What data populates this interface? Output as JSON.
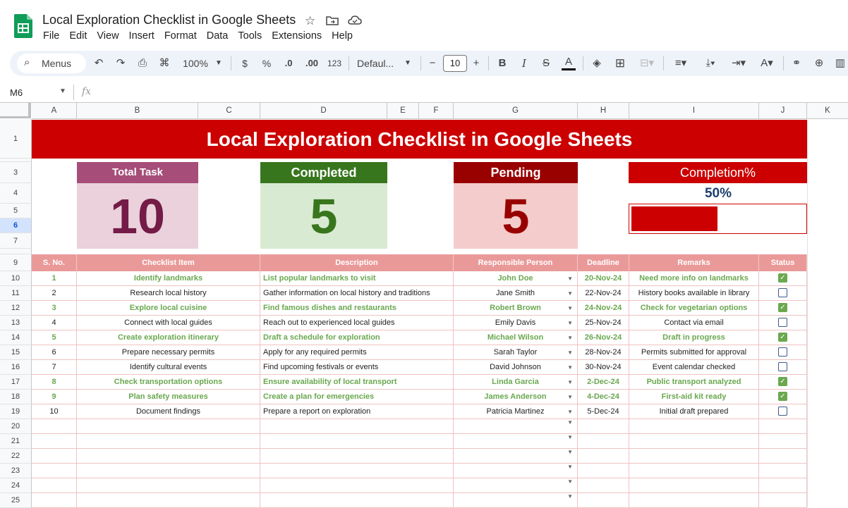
{
  "app": {
    "doc_title": "Local Exploration Checklist in Google Sheets",
    "menus": [
      "File",
      "Edit",
      "View",
      "Insert",
      "Format",
      "Data",
      "Tools",
      "Extensions",
      "Help"
    ],
    "title_icons": [
      "star-icon",
      "move-folder-icon",
      "cloud-saved-icon"
    ]
  },
  "toolbar": {
    "search_label": "Menus",
    "zoom": "100%",
    "currency": "$",
    "percent": "%",
    "decrease_decimal": ".0",
    "increase_decimal": ".00",
    "number_format": "123",
    "font": "Defaul...",
    "font_size": "10",
    "minus": "−",
    "plus": "+",
    "bold": "B",
    "italic": "I",
    "strike": "S",
    "text_color": "A"
  },
  "formula_bar": {
    "cell_ref": "M6",
    "fx": "fx"
  },
  "columns": [
    "A",
    "B",
    "C",
    "D",
    "E",
    "F",
    "G",
    "H",
    "I",
    "J",
    "K"
  ],
  "rows": [
    "1",
    "3",
    "4",
    "5",
    "6",
    "7",
    "9",
    "10",
    "11",
    "12",
    "13",
    "14",
    "15",
    "16",
    "17",
    "18",
    "19",
    "20",
    "21",
    "22",
    "23",
    "24",
    "25"
  ],
  "banner": {
    "title": "Local Exploration Checklist in Google Sheets"
  },
  "kpis": {
    "total": {
      "label": "Total Task",
      "value": "10"
    },
    "completed": {
      "label": "Completed",
      "value": "5"
    },
    "pending": {
      "label": "Pending",
      "value": "5"
    },
    "completion": {
      "label": "Completion%",
      "value": "50%",
      "fraction": 0.5
    }
  },
  "colors": {
    "red": "#cc0000",
    "total_head": "#a64d79",
    "total_body": "#ead1dc",
    "total_num": "#741b47",
    "completed_head": "#38761d",
    "completed_body": "#d9ead3",
    "completed_num": "#38761d",
    "pending_head": "#990000",
    "pending_body": "#f4cccc",
    "pending_num": "#990000",
    "done_text": "#6aa84f"
  },
  "table": {
    "headers": [
      "S. No.",
      "Checklist Item",
      "Description",
      "Responsible Person",
      "Deadline",
      "Remarks",
      "Status"
    ],
    "rows": [
      {
        "no": "1",
        "item": "Identify landmarks",
        "desc": "List popular landmarks to visit",
        "person": "John Doe",
        "deadline": "20-Nov-24",
        "remarks": "Need more info on landmarks",
        "done": true
      },
      {
        "no": "2",
        "item": "Research local history",
        "desc": "Gather information on local history and traditions",
        "person": "Jane Smith",
        "deadline": "22-Nov-24",
        "remarks": "History books available in library",
        "done": false
      },
      {
        "no": "3",
        "item": "Explore local cuisine",
        "desc": "Find famous dishes and restaurants",
        "person": "Robert Brown",
        "deadline": "24-Nov-24",
        "remarks": "Check for vegetarian options",
        "done": true
      },
      {
        "no": "4",
        "item": "Connect with local guides",
        "desc": "Reach out to experienced local guides",
        "person": "Emily Davis",
        "deadline": "25-Nov-24",
        "remarks": "Contact via email",
        "done": false
      },
      {
        "no": "5",
        "item": "Create exploration itinerary",
        "desc": "Draft a schedule for exploration",
        "person": "Michael Wilson",
        "deadline": "26-Nov-24",
        "remarks": "Draft in progress",
        "done": true
      },
      {
        "no": "6",
        "item": "Prepare necessary permits",
        "desc": "Apply for any required permits",
        "person": "Sarah Taylor",
        "deadline": "28-Nov-24",
        "remarks": "Permits submitted for approval",
        "done": false
      },
      {
        "no": "7",
        "item": "Identify cultural events",
        "desc": "Find upcoming festivals or events",
        "person": "David Johnson",
        "deadline": "30-Nov-24",
        "remarks": "Event calendar checked",
        "done": false
      },
      {
        "no": "8",
        "item": "Check transportation options",
        "desc": "Ensure availability of local transport",
        "person": "Linda Garcia",
        "deadline": "2-Dec-24",
        "remarks": "Public transport analyzed",
        "done": true
      },
      {
        "no": "9",
        "item": "Plan safety measures",
        "desc": "Create a plan for emergencies",
        "person": "James Anderson",
        "deadline": "4-Dec-24",
        "remarks": "First-aid kit ready",
        "done": true
      },
      {
        "no": "10",
        "item": "Document findings",
        "desc": "Prepare a report on exploration",
        "person": "Patricia Martinez",
        "deadline": "5-Dec-24",
        "remarks": "Initial draft prepared",
        "done": false
      }
    ]
  }
}
